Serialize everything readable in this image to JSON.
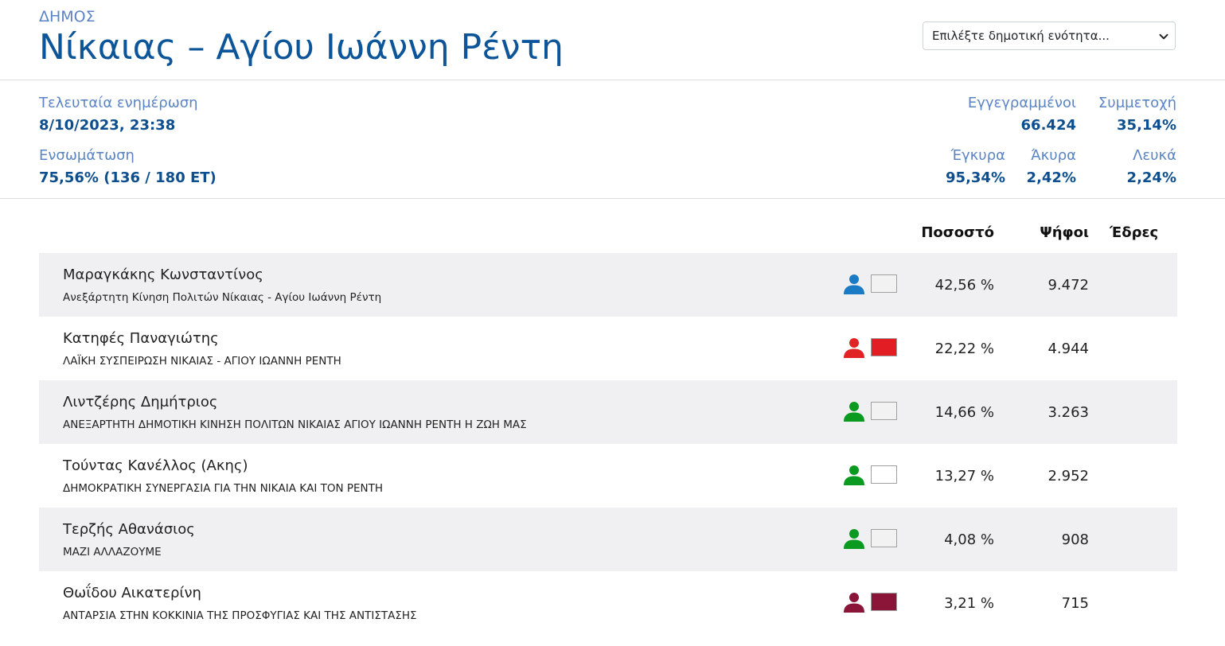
{
  "header": {
    "municipality_label": "Δήμος",
    "title": "Νίκαιας – Αγίου Ιωάννη Ρέντη",
    "unit_select": {
      "selected": "Επιλέξτε δημοτική ενότητα..."
    }
  },
  "stats": {
    "last_update_label": "Τελευταία ενημέρωση",
    "last_update_value": "8/10/2023, 23:38",
    "integration_label": "Ενσωμάτωση",
    "integration_value": "75,56% (136 / 180 ΕΤ)",
    "registered_label": "Εγγεγραμμένοι",
    "registered_value": "66.424",
    "turnout_label": "Συμμετοχή",
    "turnout_value": "35,14%",
    "valid_label": "Έγκυρα",
    "valid_value": "95,34%",
    "invalid_label": "Άκυρα",
    "invalid_value": "2,42%",
    "blank_label": "Λευκά",
    "blank_value": "2,24%"
  },
  "results": {
    "columns": {
      "percent": "Ποσοστό",
      "votes": "Ψήφοι",
      "seats": "Έδρες"
    },
    "candidates": [
      {
        "name": "Μαραγκάκης Κωνσταντίνος",
        "party": "Ανεξάρτητη Κίνηση Πολιτών Νίκαιας - Αγίου Ιωάννη Ρέντη",
        "percent": "42,56 %",
        "votes": "9.472",
        "icon_color": "#1a7bc4",
        "swatch_color": "#f2f2f2",
        "icon": "person-icon"
      },
      {
        "name": "Κατηφές Παναγιώτης",
        "party": "ΛΑΪΚΗ ΣΥΣΠΕΙΡΩΣΗ ΝΙΚΑΙΑΣ - ΑΓΙΟΥ ΙΩΑΝΝΗ ΡΕΝΤΗ",
        "percent": "22,22 %",
        "votes": "4.944",
        "icon_color": "#e02426",
        "swatch_color": "#e31d24",
        "icon": "person-icon"
      },
      {
        "name": "Λιντζέρης Δημήτριος",
        "party": "ΑΝΕΞΑΡΤΗΤΗ ΔΗΜΟΤΙΚΗ ΚΙΝΗΣΗ ΠΟΛΙΤΩΝ ΝΙΚΑΙΑΣ ΑΓΙΟΥ ΙΩΑΝΝΗ ΡΕΝΤΗ Η ΖΩΗ ΜΑΣ",
        "percent": "14,66 %",
        "votes": "3.263",
        "icon_color": "#0a9a1f",
        "swatch_color": "#f2f2f2",
        "icon": "person-icon"
      },
      {
        "name": "Τούντας Κανέλλος (Ακης)",
        "party": "ΔΗΜΟΚΡΑΤΙΚΗ ΣΥΝΕΡΓΑΣΙΑ ΓΙΑ ΤΗΝ ΝΙΚΑΙΑ ΚΑΙ ΤΟΝ ΡΕΝΤΗ",
        "percent": "13,27 %",
        "votes": "2.952",
        "icon_color": "#0a9a1f",
        "swatch_color": "#ffffff",
        "icon": "person-icon"
      },
      {
        "name": "Τερζής Αθανάσιος",
        "party": "ΜΑΖΙ ΑΛΛΑΖΟΥΜΕ",
        "percent": "4,08 %",
        "votes": "908",
        "icon_color": "#0a9a1f",
        "swatch_color": "#f2f2f2",
        "icon": "person-icon"
      },
      {
        "name": "Θωΐδου Αικατερίνη",
        "party": "ΑΝΤΑΡΣΙΑ ΣΤΗΝ ΚΟΚΚΙΝΙΑ ΤΗΣ ΠΡΟΣΦΥΓΙΑΣ ΚΑΙ ΤΗΣ ΑΝΤΙΣΤΑΣΗΣ",
        "percent": "3,21 %",
        "votes": "715",
        "icon_color": "#8a1538",
        "swatch_color": "#8a1538",
        "icon": "person-icon"
      }
    ]
  },
  "colors": {
    "title": "#0d5599",
    "label": "#5b84c4",
    "value": "#0d4f8e",
    "row_shade": "#f0f0f2"
  }
}
